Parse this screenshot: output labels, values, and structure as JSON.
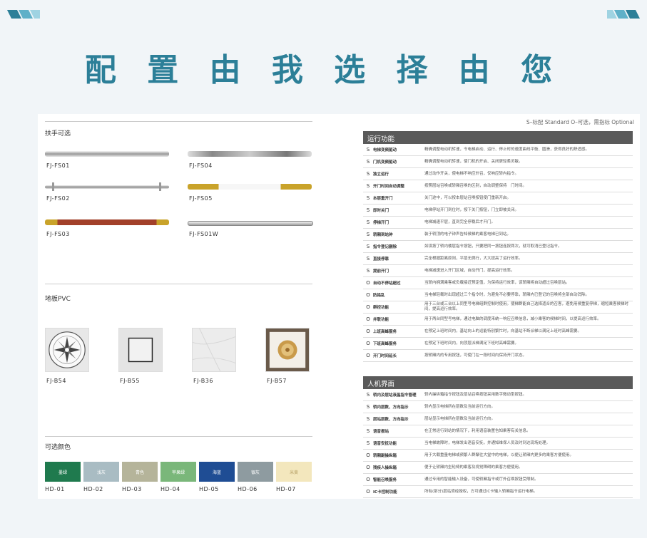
{
  "title": "配 置 由 我   选 择 由 您",
  "legend": "S–标配 Standard    O–可选，需指标 Optional",
  "handrail": {
    "label": "扶手可选",
    "items": [
      {
        "code": "FJ-FS01"
      },
      {
        "code": "FJ-FS04"
      },
      {
        "code": "FJ-FS02"
      },
      {
        "code": "FJ-FS05"
      },
      {
        "code": "FJ-FS03"
      },
      {
        "code": "FJ-FS01W"
      }
    ]
  },
  "floor": {
    "label": "地板PVC",
    "items": [
      {
        "code": "FJ-B54"
      },
      {
        "code": "FJ-B55"
      },
      {
        "code": "FJ-B36"
      },
      {
        "code": "FJ-B57"
      }
    ]
  },
  "colors": {
    "label": "可选颜色",
    "items": [
      {
        "name": "墨绿",
        "code": "HD-01",
        "color": "#1f7a4e"
      },
      {
        "name": "浅灰",
        "code": "HD-02",
        "color": "#a9bcc3"
      },
      {
        "name": "青色",
        "code": "HD-03",
        "color": "#b5b49a"
      },
      {
        "name": "苹果绿",
        "code": "HD-04",
        "color": "#7ab77a"
      },
      {
        "name": "海蓝",
        "code": "HD-05",
        "color": "#1f4d94"
      },
      {
        "name": "银灰",
        "code": "HD-06",
        "color": "#8e9ba0"
      },
      {
        "name": "米黄",
        "code": "HD-07",
        "color": "#f3e7bd"
      }
    ]
  },
  "operation": {
    "header": "运行功能",
    "rows": [
      {
        "s": "S",
        "name": "电梯变频驱动",
        "desc": "精确调整电动机转速，令电梯启动、运行、停止时的速度曲线平衡、圆滑，获得良好的舒适感。"
      },
      {
        "s": "S",
        "name": "门机变频驱动",
        "desc": "精确调整电动机转速，使门机的开启、关闭更轻柔灵敏。"
      },
      {
        "s": "S",
        "name": "独立运行",
        "desc": "通过动作开关，使电梯不响应外召，仅响应轿内指令。"
      },
      {
        "s": "S",
        "name": "开门时间自动调整",
        "desc": "按照层站召唤或轿厢召唤的区别，自动调整保持　门时间。"
      },
      {
        "s": "S",
        "name": "本层重开门",
        "desc": "关门途中，可以按本层站召唤按钮使门重新开启。"
      },
      {
        "s": "S",
        "name": "即时关门",
        "desc": "电梯停站开门到位时，按下关门按钮，门立即被关闭。"
      },
      {
        "s": "S",
        "name": "停梯开门",
        "desc": "电梯减速平层，直到完全停稳后才开门。"
      },
      {
        "s": "S",
        "name": "轿厢到站钟",
        "desc": "装于轿顶的电子钟声告知候梯的乘客电梯已到站。"
      },
      {
        "s": "S",
        "name": "指令登记删除",
        "desc": "如误按了轿内楼层指令按钮，只要把同一按钮连按两次，就可取消已登记指令。"
      },
      {
        "s": "S",
        "name": "直接停靠",
        "desc": "完全根据距离原则，平层无爬行，大大提高了运行效率。"
      },
      {
        "s": "S",
        "name": "提前开门",
        "desc": "电梯减速进入开门区域，自动开门，提高运行效率。"
      },
      {
        "s": "O",
        "name": "自动不停站超过",
        "desc": "当轿内拥满乘客或负载接近预定值，为保持运行效率，该轿厢将自动超过召唤层站。"
      },
      {
        "s": "O",
        "name": "防捣乱",
        "desc": "当电梯轻载时出现超过三个指令时，为避免不必要停靠，轿厢内已登记的召唤将全部自动消除。"
      },
      {
        "s": "O",
        "name": "群控功能",
        "desc": "用于三台或三台以上同型号电梯组群控制时使用。使梯群能自己选择适合的召客，避免用候重复停梯，缩短乘客候梯时间，提高运行效率。"
      },
      {
        "s": "O",
        "name": "并联功能",
        "desc": "用于两台同型号电梯，通过电脑的调度来统一响应召唤信息，减小乘客的候梯时间，以提高运行效率。"
      },
      {
        "s": "O",
        "name": "上班高峰服务",
        "desc": "在预定上班时间内，基站向上的运能特别繁忙时，向基站不断派梯以满足上班时高峰需要。"
      },
      {
        "s": "O",
        "name": "下班高峰服务",
        "desc": "在预定下班时间内，向顶层派梯满足下班时高峰需要。"
      },
      {
        "s": "O",
        "name": "开门时间延长",
        "desc": "按轿厢内的专用按钮，可使门在一段时间内保持开门状态。"
      }
    ]
  },
  "hmi": {
    "header": "人机界面",
    "rows": [
      {
        "s": "S",
        "name": "轿内及层站液晶指令管理",
        "desc": "轿内操纵箱指令按钮及层站召唤按钮采用数字微动型按钮。"
      },
      {
        "s": "S",
        "name": "轿内层数、方向指示",
        "desc": "轿内显示电梯所在层数及当前运行方向。"
      },
      {
        "s": "S",
        "name": "层站层数、方向指示",
        "desc": "层站显示电梯所在层数及当前运行方向。"
      },
      {
        "s": "S",
        "name": "语音报站",
        "desc": "在正常运行到站的情况下，利用语音装置告知乘客有关信息。"
      },
      {
        "s": "S",
        "name": "语音安抚功能",
        "desc": "当电梯故障时，电梯发出语音安抚，并通知维保人员及时到达现场处理。"
      },
      {
        "s": "O",
        "name": "轿厢副操纵箱",
        "desc": "用于大载重量电梯或频繁人群聚往大堂中的电梯，以便让轿厢内更多的乘客方便使用。"
      },
      {
        "s": "O",
        "name": "残疾人操纵箱",
        "desc": "便于让轿厢内坐轮椅的乘客及视觉障碍的乘客方便使用。"
      },
      {
        "s": "O",
        "name": "智能召唤服务",
        "desc": "通过专用的智能输入设备，可使轿厢指令或厅外召唤按钮受限制。"
      },
      {
        "s": "O",
        "name": "IC卡控制功能",
        "desc": "所有(部分)层站须经授权，方可通过IC卡输入轿厢指令运行电梯。"
      }
    ]
  }
}
